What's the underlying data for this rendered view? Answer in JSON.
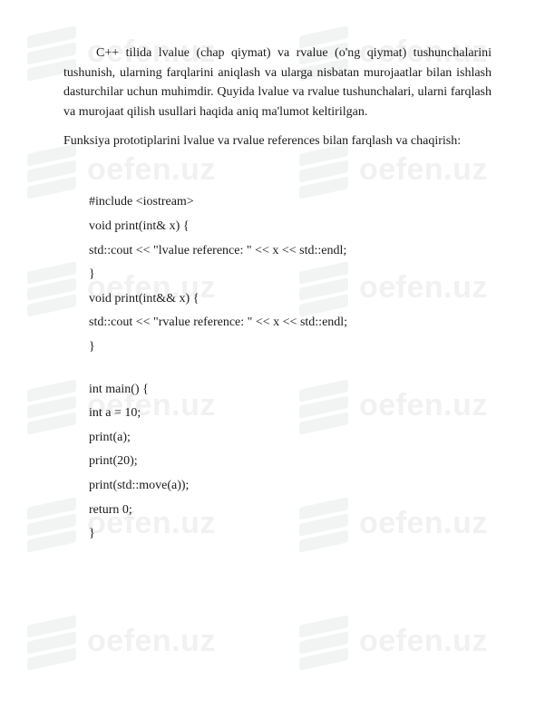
{
  "watermark": {
    "brand": "oefen.uz"
  },
  "paragraphs": {
    "p1": "C++ tilida lvalue (chap qiymat) va rvalue (o'ng qiymat) tushunchalarini tushunish, ularning farqlarini aniqlash va ularga nisbatan murojaatlar bilan ishlash dasturchilar uchun muhimdir. Quyida lvalue va rvalue tushunchalari, ularni farqlash va murojaat qilish usullari haqida aniq ma'lumot keltirilgan.",
    "p2": "Funksiya prototiplarini lvalue va rvalue references bilan farqlash va chaqirish:"
  },
  "code": {
    "l01": "#include <iostream>",
    "l02": "void print(int& x) {",
    "l03": "    std::cout << \"lvalue reference: \" << x << std::endl;",
    "l04": "}",
    "l05": "void print(int&& x) {",
    "l06": "    std::cout << \"rvalue reference: \" << x << std::endl;",
    "l07": "}",
    "l08": "int main() {",
    "l09": "    int a = 10;",
    "l10": "    print(a);",
    "l11": "    print(20);",
    "l12": "    print(std::move(a));",
    "l13": "    return 0;",
    "l14": "}"
  }
}
